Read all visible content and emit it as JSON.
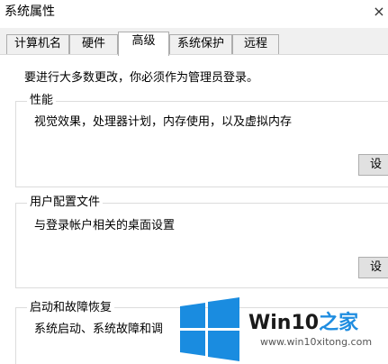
{
  "window": {
    "title": "系统属性",
    "close_glyph": "×"
  },
  "tabs": [
    {
      "label": "计算机名"
    },
    {
      "label": "硬件"
    },
    {
      "label": "高级",
      "active": true
    },
    {
      "label": "系统保护"
    },
    {
      "label": "远程"
    }
  ],
  "admin_note": "要进行大多数更改，你必须作为管理员登录。",
  "groups": {
    "performance": {
      "title": "性能",
      "desc": "视觉效果，处理器计划，内存使用，以及虚拟内存",
      "button": "设"
    },
    "profiles": {
      "title": "用户配置文件",
      "desc": "与登录帐户相关的桌面设置",
      "button": "设"
    },
    "startup": {
      "title": "启动和故障恢复",
      "desc": "系统启动、系统故障和调"
    }
  },
  "watermark": {
    "brand_main": "Win10",
    "brand_zhi": "之家",
    "url": "www.win10xitong.com",
    "logo_color": "#1a8ce0"
  }
}
